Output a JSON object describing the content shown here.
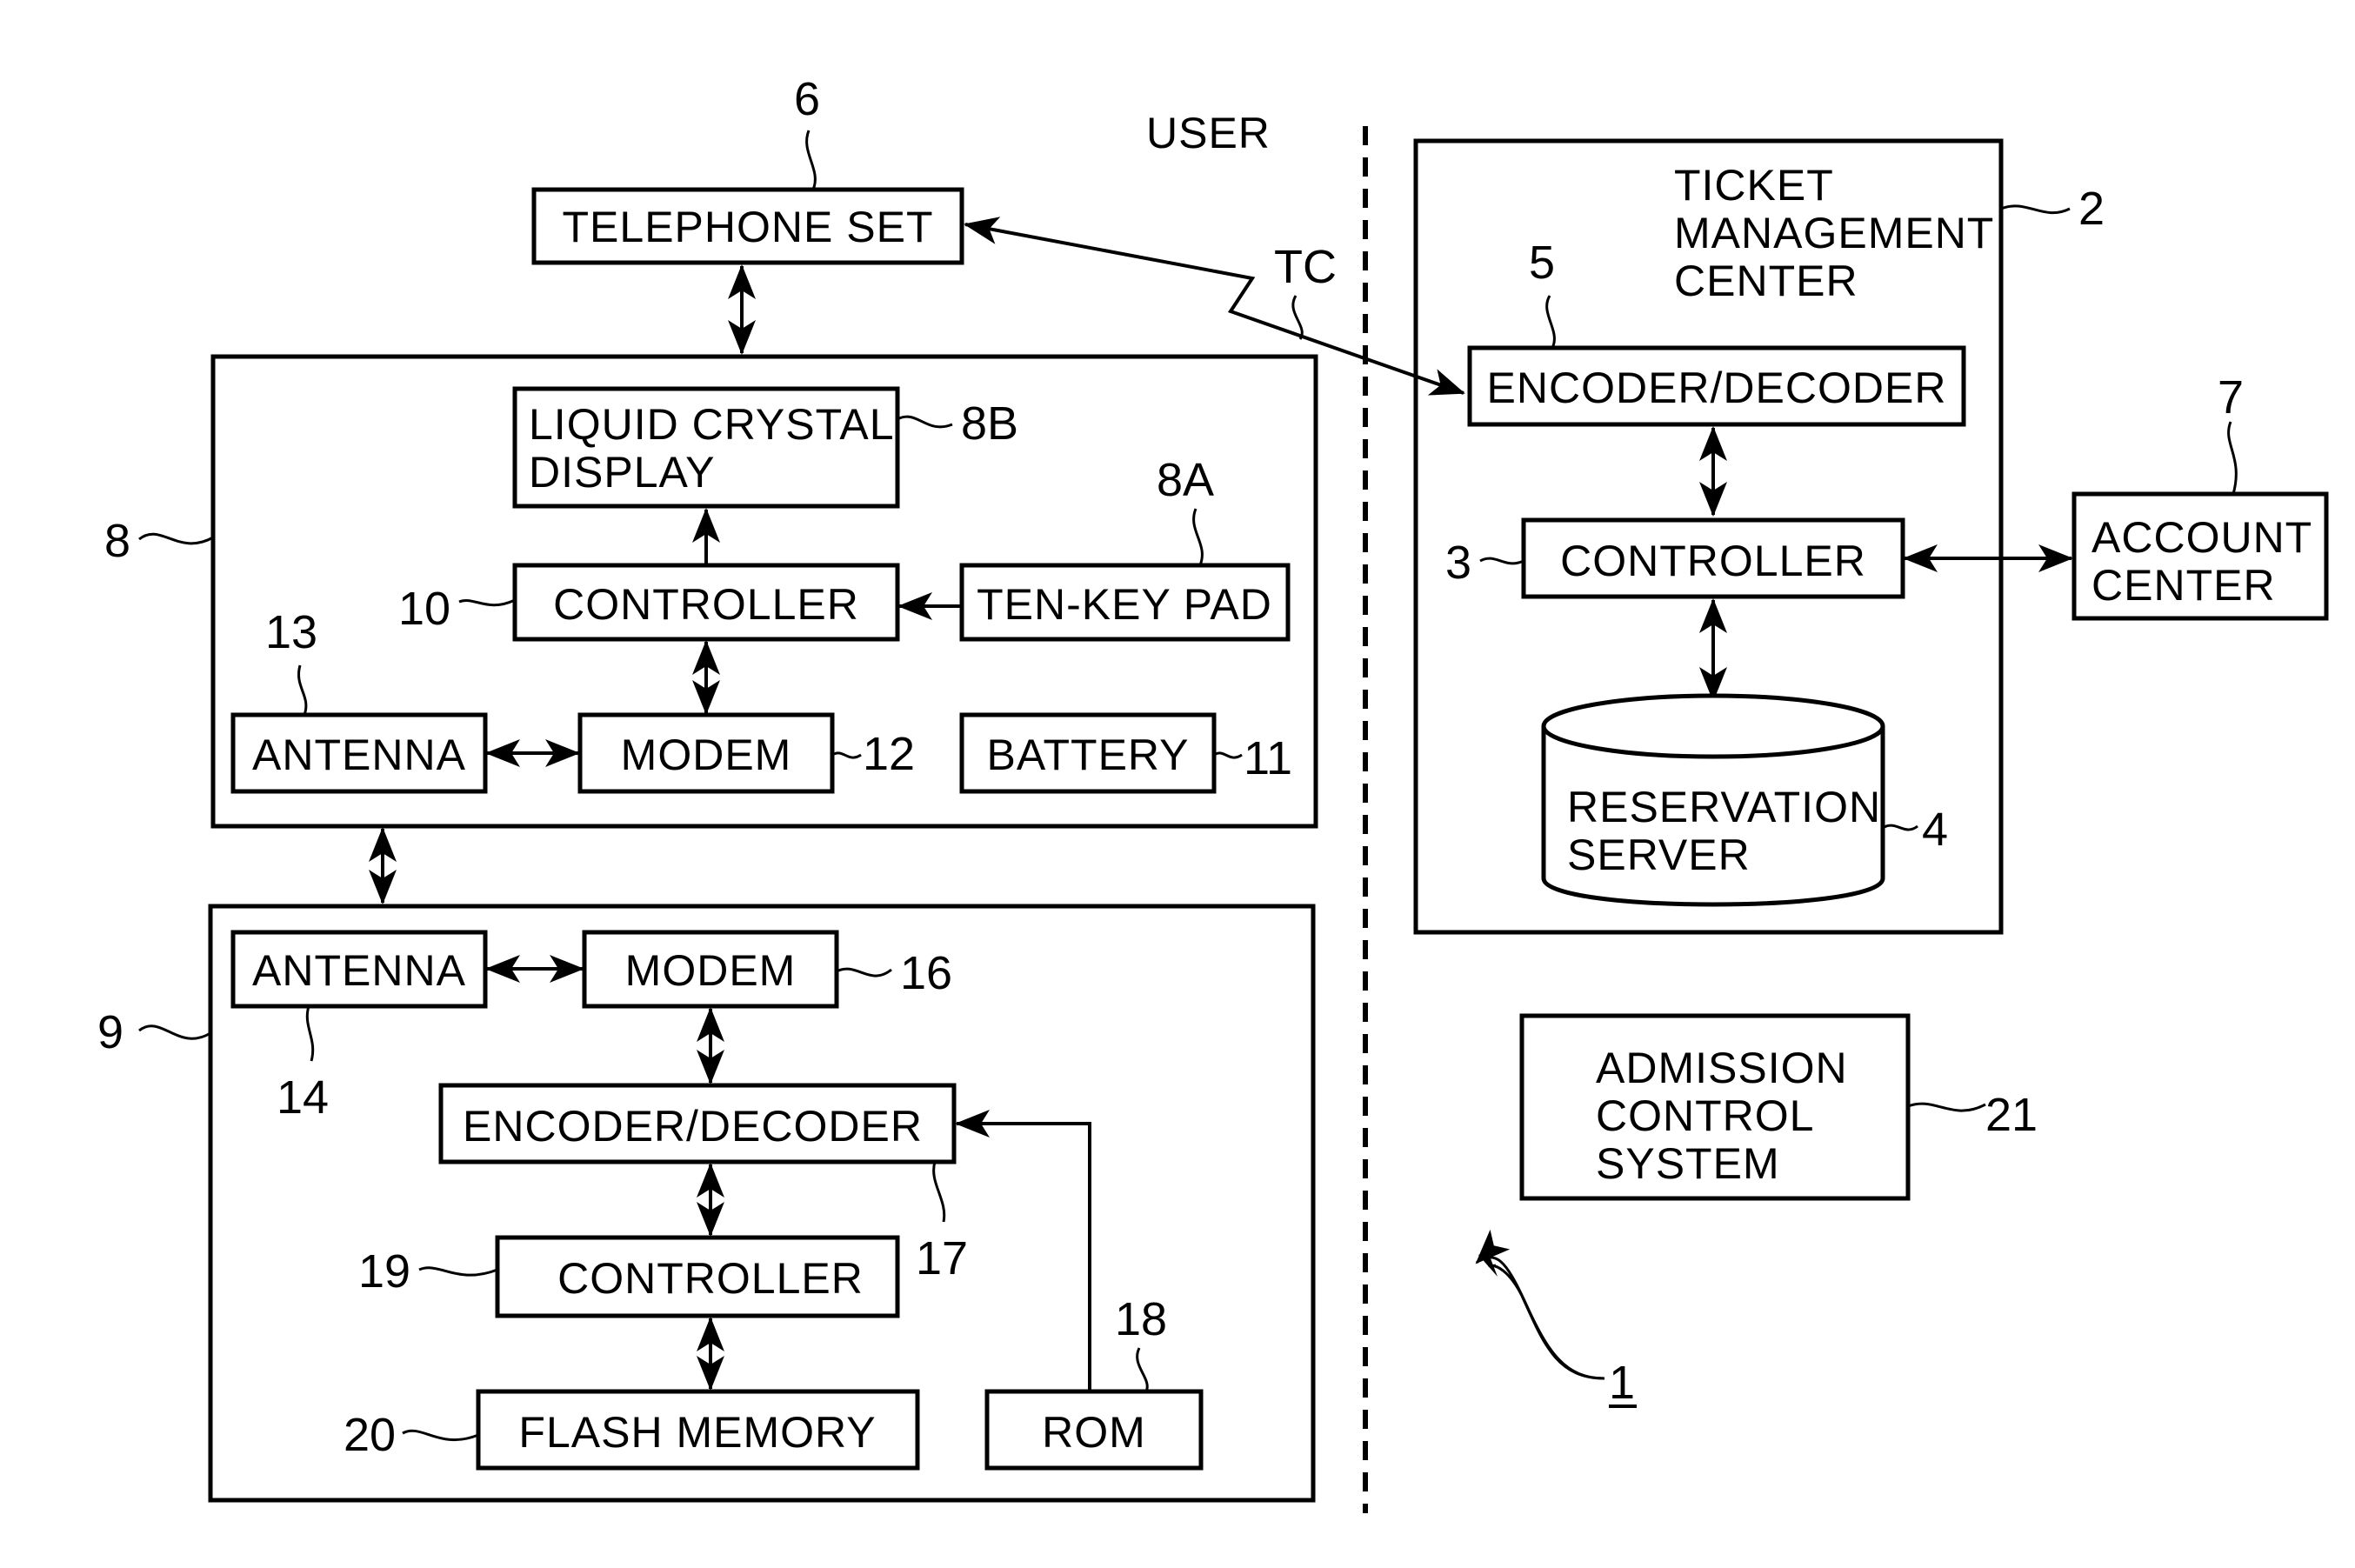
{
  "figure": {
    "system_ref": "1",
    "side_labels": {
      "user": "USER",
      "channel": "TC"
    }
  },
  "telephone": {
    "label": "TELEPHONE SET",
    "ref": "6"
  },
  "mobile_terminal": {
    "ref": "8",
    "lcd": {
      "lines": [
        "LIQUID CRYSTAL",
        "DISPLAY"
      ],
      "ref": "8B"
    },
    "ten_key": {
      "label": "TEN-KEY PAD",
      "ref": "8A"
    },
    "controller": {
      "label": "CONTROLLER",
      "ref": "10"
    },
    "antenna": {
      "label": "ANTENNA",
      "ref": "13"
    },
    "modem": {
      "label": "MODEM",
      "ref": "12"
    },
    "battery": {
      "label": "BATTERY",
      "ref": "11"
    }
  },
  "ic_card": {
    "ref": "9",
    "antenna": {
      "label": "ANTENNA",
      "ref": "14"
    },
    "modem": {
      "label": "MODEM",
      "ref": "16"
    },
    "encoder": {
      "label": "ENCODER/DECODER",
      "ref": "17"
    },
    "controller": {
      "label": "CONTROLLER",
      "ref": "19"
    },
    "flash": {
      "label": "FLASH MEMORY",
      "ref": "20"
    },
    "rom": {
      "label": "ROM",
      "ref": "18"
    }
  },
  "ticket_center": {
    "title_lines": [
      "TICKET",
      "MANAGEMENT",
      "CENTER"
    ],
    "ref": "2",
    "encoder": {
      "label": "ENCODER/DECODER",
      "ref": "5"
    },
    "controller": {
      "label": "CONTROLLER",
      "ref": "3"
    },
    "server": {
      "lines": [
        "RESERVATION",
        "SERVER"
      ],
      "ref": "4"
    }
  },
  "account_center": {
    "lines": [
      "ACCOUNT",
      "CENTER"
    ],
    "ref": "7"
  },
  "admission": {
    "lines": [
      "ADMISSION",
      "CONTROL",
      "SYSTEM"
    ],
    "ref": "21"
  }
}
